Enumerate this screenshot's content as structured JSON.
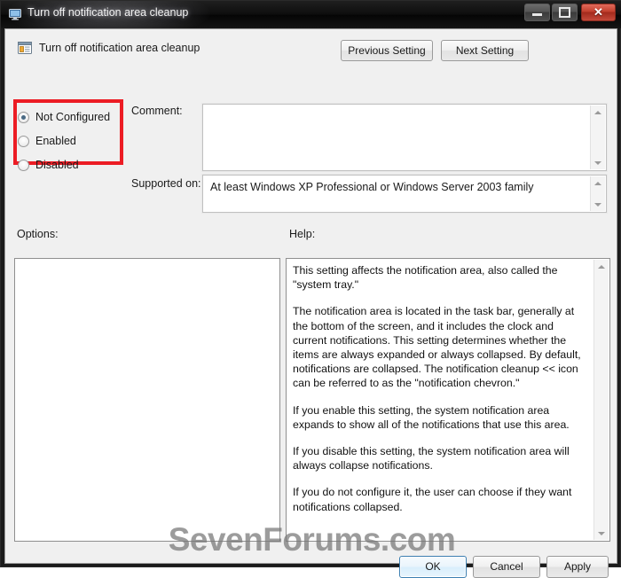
{
  "window": {
    "title": "Turn off notification area cleanup",
    "icon": "monitor-icon",
    "controls": {
      "minimize": "minimize-icon",
      "maximize": "maximize-icon",
      "close": "close-icon"
    }
  },
  "header": {
    "icon": "policy-setting-icon",
    "title": "Turn off notification area cleanup",
    "previous_setting": "Previous Setting",
    "next_setting": "Next Setting"
  },
  "state": {
    "options": [
      {
        "label": "Not Configured",
        "selected": true
      },
      {
        "label": "Enabled",
        "selected": false
      },
      {
        "label": "Disabled",
        "selected": false
      }
    ],
    "highlight_color": "#ec1c24"
  },
  "comment": {
    "label": "Comment:",
    "value": ""
  },
  "supported": {
    "label": "Supported on:",
    "value": "At least Windows XP Professional or Windows Server 2003 family"
  },
  "options_panel": {
    "label": "Options:",
    "value": ""
  },
  "help_panel": {
    "label": "Help:",
    "paragraphs": [
      "This setting affects the notification area, also called the \"system tray.\"",
      "The notification area is located in the task bar, generally at the bottom of the screen, and it includes the clock and current notifications. This setting determines whether the items are always expanded or always collapsed. By default, notifications are collapsed. The notification cleanup << icon can be referred to as the \"notification chevron.\"",
      "If you enable this setting, the system notification area expands to show all of the notifications that use this area.",
      "If you disable this setting, the system notification area will always collapse notifications.",
      "If you do not configure it, the user can choose if they want notifications collapsed."
    ]
  },
  "watermark": {
    "text": "SevenForums.com"
  },
  "footer": {
    "ok": "OK",
    "cancel": "Cancel",
    "apply": "Apply"
  }
}
